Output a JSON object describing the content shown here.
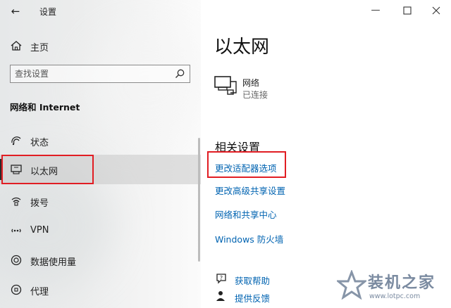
{
  "window": {
    "title": "设置"
  },
  "sidebar": {
    "home_label": "主页",
    "search_placeholder": "查找设置",
    "section_title": "网络和 Internet",
    "items": [
      {
        "label": "状态",
        "icon": "status-icon"
      },
      {
        "label": "以太网",
        "icon": "ethernet-icon",
        "selected": true
      },
      {
        "label": "拨号",
        "icon": "dialup-icon"
      },
      {
        "label": "VPN",
        "icon": "vpn-icon"
      },
      {
        "label": "数据使用量",
        "icon": "data-usage-icon"
      },
      {
        "label": "代理",
        "icon": "proxy-icon"
      }
    ]
  },
  "main": {
    "title": "以太网",
    "network": {
      "name": "网络",
      "status": "已连接",
      "icon": "ethernet-network-icon"
    },
    "related_title": "相关设置",
    "related_links": [
      "更改适配器选项",
      "更改高级共享设置",
      "网络和共享中心",
      "Windows 防火墙"
    ],
    "help": [
      {
        "label": "获取帮助",
        "icon": "help-icon"
      },
      {
        "label": "提供反馈",
        "icon": "feedback-icon"
      }
    ]
  },
  "watermark": {
    "brand": "装机之家",
    "url": "www.lotpc.com"
  },
  "colors": {
    "link": "#0063b1",
    "highlight": "#e11d23",
    "watermark": "#7a8aa0"
  }
}
